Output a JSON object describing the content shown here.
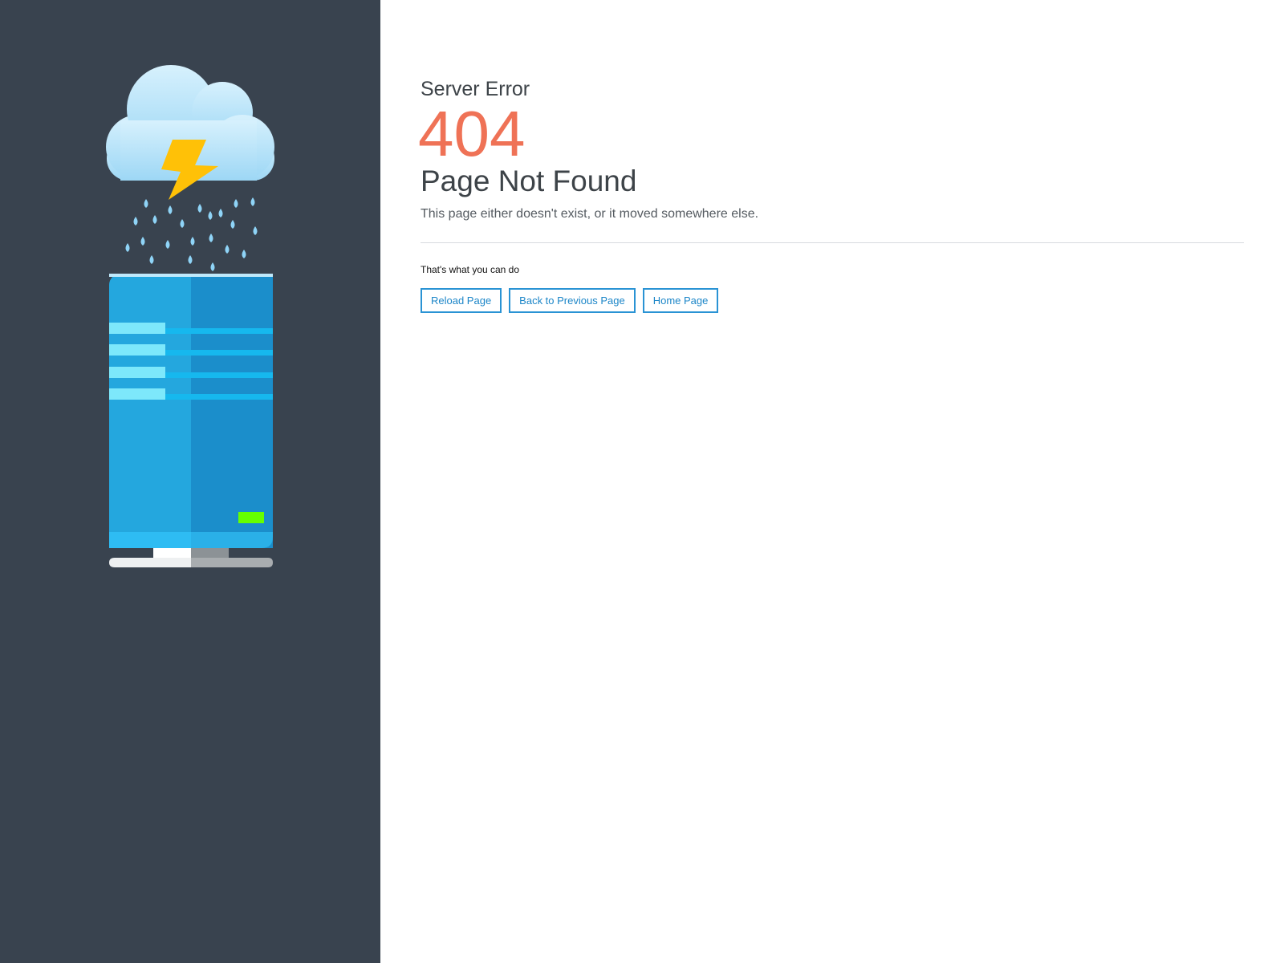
{
  "error": {
    "label": "Server Error",
    "code": "404",
    "title": "Page Not Found",
    "message": "This page either doesn't exist, or it moved somewhere else."
  },
  "actions": {
    "title": "That's what you can do",
    "buttons": [
      {
        "label": "Reload Page"
      },
      {
        "label": "Back to Previous Page"
      },
      {
        "label": "Home Page"
      }
    ]
  },
  "illustration": {
    "icons": [
      "cloud-icon",
      "lightning-bolt-icon",
      "raindrop-icon",
      "server-tower-icon",
      "status-led-icon"
    ]
  },
  "colors": {
    "sidebar_bg": "#39434f",
    "error_code": "#ef7256",
    "button_border": "#2a93d4",
    "button_text": "#1c86c8",
    "heading_text": "#3d4348",
    "server_light": "#24a7de",
    "server_dark": "#1b8ecb",
    "status_led": "#66ff00",
    "lightning": "#ffc107"
  }
}
